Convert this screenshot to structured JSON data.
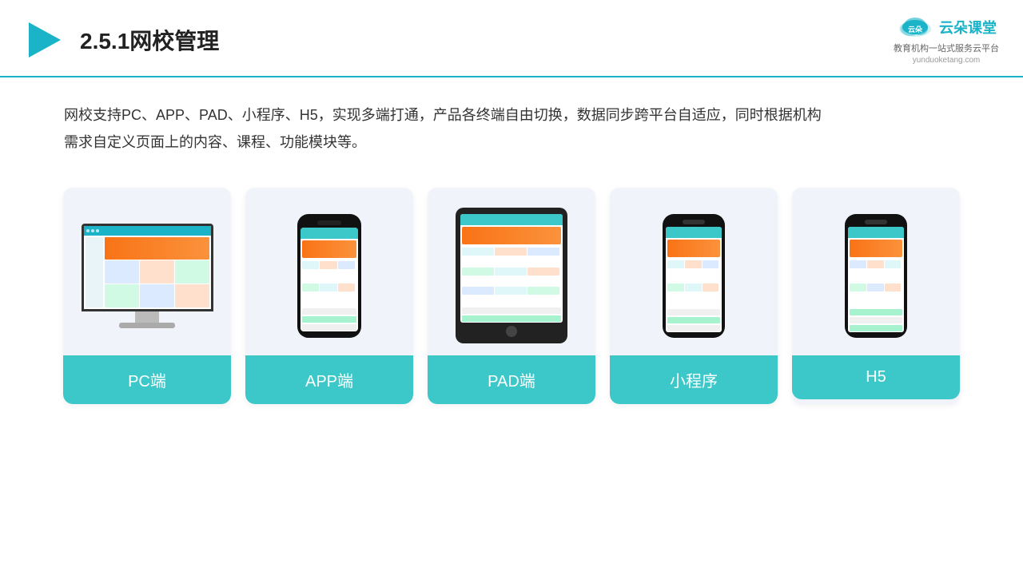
{
  "header": {
    "title": "2.5.1网校管理",
    "logo_name": "云朵课堂",
    "logo_url": "yunduoketang.com",
    "logo_tagline": "教育机构一站\n式服务云平台"
  },
  "description": {
    "text": "网校支持PC、APP、PAD、小程序、H5，实现多端打通，产品各终端自由切换，数据同步跨平台自适应，同时根据机构需求自定义页面上的内容、课程、功能模块等。"
  },
  "cards": [
    {
      "label": "PC端",
      "type": "pc"
    },
    {
      "label": "APP端",
      "type": "phone"
    },
    {
      "label": "PAD端",
      "type": "tablet"
    },
    {
      "label": "小程序",
      "type": "phone_sm"
    },
    {
      "label": "H5",
      "type": "phone_sm2"
    }
  ],
  "colors": {
    "accent": "#1ab3c8",
    "card_bg": "#f0f4fa",
    "card_label_bg": "#3cc8c8"
  }
}
